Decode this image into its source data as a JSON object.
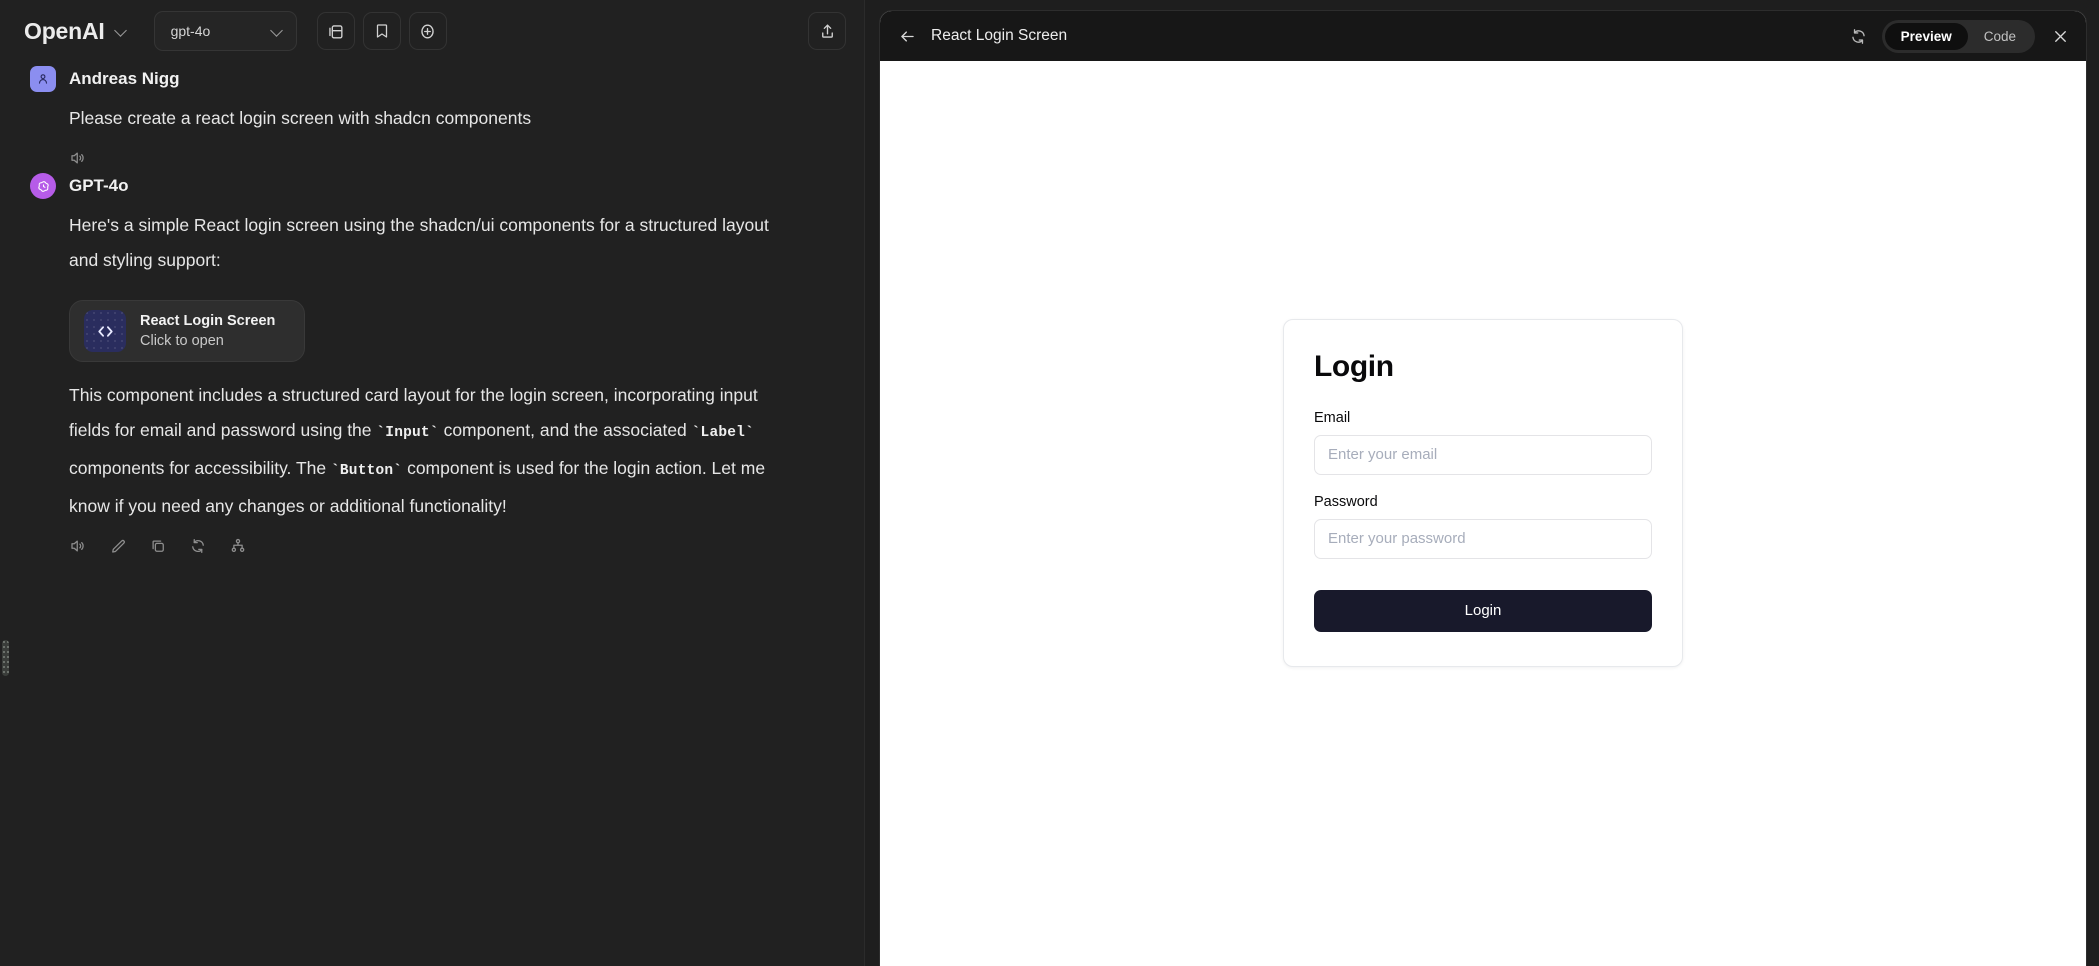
{
  "chat": {
    "topbar": {
      "brand": "OpenAI",
      "brand_chevron_icon": "chevron-down-icon",
      "model": "gpt-4o",
      "model_chevron_icon": "chevron-down-icon",
      "sidebar_toggle_icon": "panel-toggle-icon",
      "bookmark_icon": "bookmark-icon",
      "new_chat_icon": "plus-circle-icon",
      "share_icon": "share-upload-icon"
    },
    "messages": [
      {
        "role": "user",
        "author": "Andreas Nigg",
        "avatar_icon": "user-avatar-icon",
        "avatar_color": "#8b8ef0",
        "text": "Please create a react login screen with shadcn components",
        "actions": [
          "speaker-icon"
        ]
      },
      {
        "role": "assistant",
        "author": "GPT-4o",
        "avatar_icon": "openai-logo-icon",
        "avatar_color": "#b65ce8",
        "intro": "Here's a simple React login screen using the shadcn/ui components for a structured layout and styling support:",
        "artifact": {
          "title": "React Login Screen",
          "subtitle": "Click to open",
          "icon": "code-brackets-icon"
        },
        "outro_parts": [
          {
            "type": "text",
            "value": "This component includes a structured card layout for the login screen, incorporating input fields for email and password using the "
          },
          {
            "type": "code",
            "value": "`Input`"
          },
          {
            "type": "text",
            "value": " component, and the associated "
          },
          {
            "type": "code",
            "value": "`Label`"
          },
          {
            "type": "text",
            "value": " components for accessibility. The "
          },
          {
            "type": "code",
            "value": "`Button`"
          },
          {
            "type": "text",
            "value": " component is used for the login action. Let me know if you need any changes or additional functionality!"
          }
        ],
        "actions": [
          "speaker-icon",
          "edit-pencil-icon",
          "copy-icon",
          "regenerate-icon",
          "branch-icon"
        ]
      }
    ],
    "resize_handle_icon": "drag-handle-icon"
  },
  "artifact_panel": {
    "back_icon": "arrow-left-icon",
    "title": "React Login Screen",
    "refresh_icon": "refresh-icon",
    "view_tabs": [
      {
        "label": "Preview",
        "active": true
      },
      {
        "label": "Code",
        "active": false
      }
    ],
    "close_icon": "close-x-icon",
    "preview": {
      "card_title": "Login",
      "fields": [
        {
          "label": "Email",
          "placeholder": "Enter your email",
          "value": "",
          "type": "email"
        },
        {
          "label": "Password",
          "placeholder": "Enter your password",
          "value": "",
          "type": "password"
        }
      ],
      "submit_label": "Login"
    }
  },
  "colors": {
    "app_background": "#1e1e1e",
    "chat_background": "#212121",
    "artifact_header": "#171717",
    "preview_background": "#ffffff",
    "user_avatar": "#8b8ef0",
    "assistant_avatar": "#b65ce8",
    "artifact_thumb": "#2a2d5e",
    "login_button": "#18192b"
  }
}
